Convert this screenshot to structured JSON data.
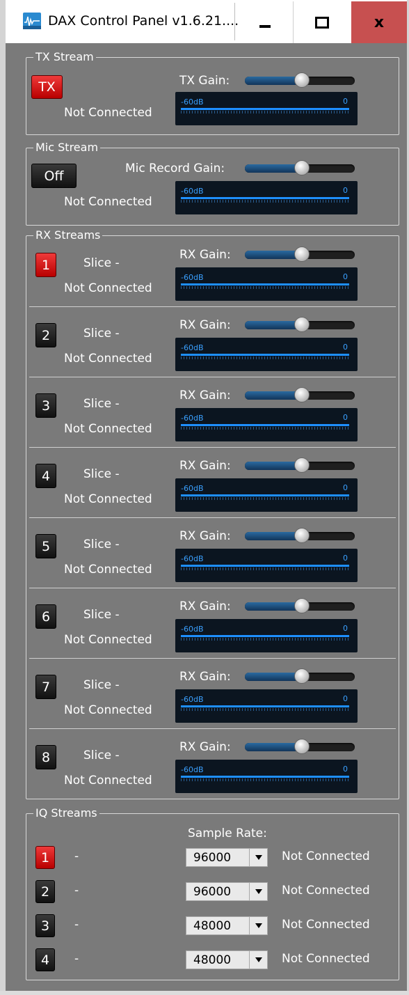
{
  "window": {
    "title": "DAX Control Panel v1.6.21....",
    "close_glyph": "x"
  },
  "tx": {
    "group_label": "TX Stream",
    "button_label": "TX",
    "gain_label": "TX Gain:",
    "status": "Not Connected",
    "meter_min": "-60dB",
    "meter_max": "0",
    "gain_level": 0.52
  },
  "mic": {
    "group_label": "Mic Stream",
    "button_label": "Off",
    "gain_label": "Mic Record Gain:",
    "status": "Not Connected",
    "meter_min": "-60dB",
    "meter_max": "0",
    "gain_level": 0.52
  },
  "rx": {
    "group_label": "RX Streams",
    "streams": [
      {
        "number": "1",
        "slice": "Slice -",
        "gain_label": "RX Gain:",
        "status": "Not Connected",
        "meter_min": "-60dB",
        "meter_max": "0",
        "active": true,
        "gain_level": 0.52
      },
      {
        "number": "2",
        "slice": "Slice -",
        "gain_label": "RX Gain:",
        "status": "Not Connected",
        "meter_min": "-60dB",
        "meter_max": "0",
        "active": false,
        "gain_level": 0.52
      },
      {
        "number": "3",
        "slice": "Slice -",
        "gain_label": "RX Gain:",
        "status": "Not Connected",
        "meter_min": "-60dB",
        "meter_max": "0",
        "active": false,
        "gain_level": 0.52
      },
      {
        "number": "4",
        "slice": "Slice -",
        "gain_label": "RX Gain:",
        "status": "Not Connected",
        "meter_min": "-60dB",
        "meter_max": "0",
        "active": false,
        "gain_level": 0.52
      },
      {
        "number": "5",
        "slice": "Slice -",
        "gain_label": "RX Gain:",
        "status": "Not Connected",
        "meter_min": "-60dB",
        "meter_max": "0",
        "active": false,
        "gain_level": 0.52
      },
      {
        "number": "6",
        "slice": "Slice -",
        "gain_label": "RX Gain:",
        "status": "Not Connected",
        "meter_min": "-60dB",
        "meter_max": "0",
        "active": false,
        "gain_level": 0.52
      },
      {
        "number": "7",
        "slice": "Slice -",
        "gain_label": "RX Gain:",
        "status": "Not Connected",
        "meter_min": "-60dB",
        "meter_max": "0",
        "active": false,
        "gain_level": 0.52
      },
      {
        "number": "8",
        "slice": "Slice -",
        "gain_label": "RX Gain:",
        "status": "Not Connected",
        "meter_min": "-60dB",
        "meter_max": "0",
        "active": false,
        "gain_level": 0.52
      }
    ]
  },
  "iq": {
    "group_label": "IQ Streams",
    "sample_rate_label": "Sample Rate:",
    "streams": [
      {
        "number": "1",
        "dash": "-",
        "rate": "96000",
        "status": "Not Connected",
        "active": true
      },
      {
        "number": "2",
        "dash": "-",
        "rate": "96000",
        "status": "Not Connected",
        "active": false
      },
      {
        "number": "3",
        "dash": "-",
        "rate": "48000",
        "status": "Not Connected",
        "active": false
      },
      {
        "number": "4",
        "dash": "-",
        "rate": "48000",
        "status": "Not Connected",
        "active": false
      }
    ]
  },
  "colors": {
    "background": "#7a7a7a",
    "accent_red": "#d41414",
    "meter_blue": "#1e8fff",
    "meter_bg": "#0b1520"
  }
}
